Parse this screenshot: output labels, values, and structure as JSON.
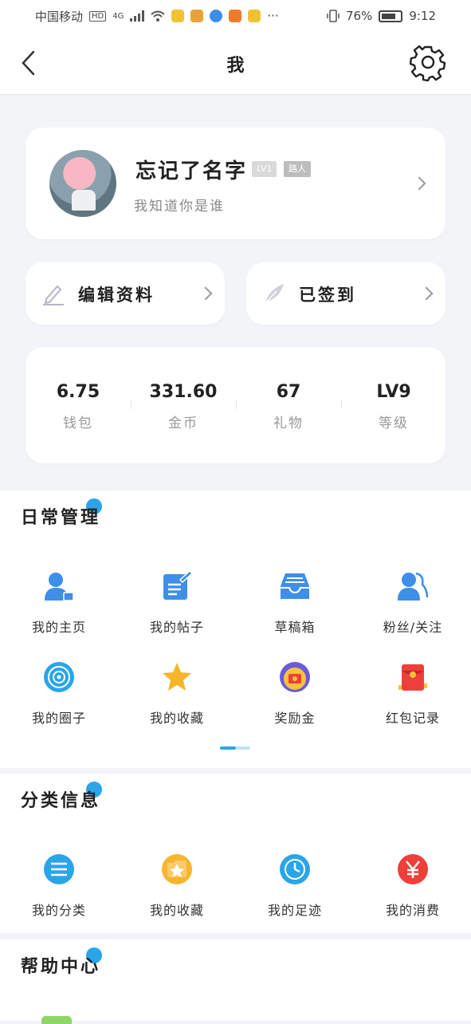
{
  "status_bar": {
    "carrier": "中国移动",
    "hd": "HD",
    "network": "4G",
    "battery": "76%",
    "battery_fraction": 0.76,
    "time": "9:12",
    "more": "···"
  },
  "header": {
    "title": "我",
    "back_icon": "chevron-left-icon",
    "settings_icon": "gear-icon"
  },
  "profile": {
    "name": "忘记了名字",
    "level_tag": "LV1",
    "role_tag": "路人",
    "bio": "我知道你是谁"
  },
  "quick_actions": [
    {
      "label": "编辑资料",
      "icon": "pencil-icon"
    },
    {
      "label": "已签到",
      "icon": "feather-icon"
    }
  ],
  "stats": [
    {
      "value": "6.75",
      "label": "钱包"
    },
    {
      "value": "331.60",
      "label": "金币"
    },
    {
      "value": "67",
      "label": "礼物"
    },
    {
      "value": "LV9",
      "label": "等级"
    }
  ],
  "sections": {
    "daily": {
      "title": "日常管理",
      "items": [
        {
          "label": "我的主页",
          "icon": "user-card-icon"
        },
        {
          "label": "我的帖子",
          "icon": "post-edit-icon"
        },
        {
          "label": "草稿箱",
          "icon": "inbox-icon"
        },
        {
          "label": "粉丝/关注",
          "icon": "followers-icon"
        },
        {
          "label": "我的圈子",
          "icon": "circle-target-icon"
        },
        {
          "label": "我的收藏",
          "icon": "star-icon"
        },
        {
          "label": "奖励金",
          "icon": "reward-icon"
        },
        {
          "label": "红包记录",
          "icon": "red-envelope-icon"
        }
      ]
    },
    "category": {
      "title": "分类信息",
      "items": [
        {
          "label": "我的分类",
          "icon": "list-icon"
        },
        {
          "label": "我的收藏",
          "icon": "star-folder-icon"
        },
        {
          "label": "我的足迹",
          "icon": "clock-icon"
        },
        {
          "label": "我的消费",
          "icon": "yen-icon"
        }
      ]
    },
    "help": {
      "title": "帮助中心"
    }
  },
  "colors": {
    "accent": "#2aa5e9",
    "icon_blue": "#3d8fe8",
    "star": "#f7b52c",
    "red": "#ef3f3a",
    "background": "#f3f4f7"
  }
}
